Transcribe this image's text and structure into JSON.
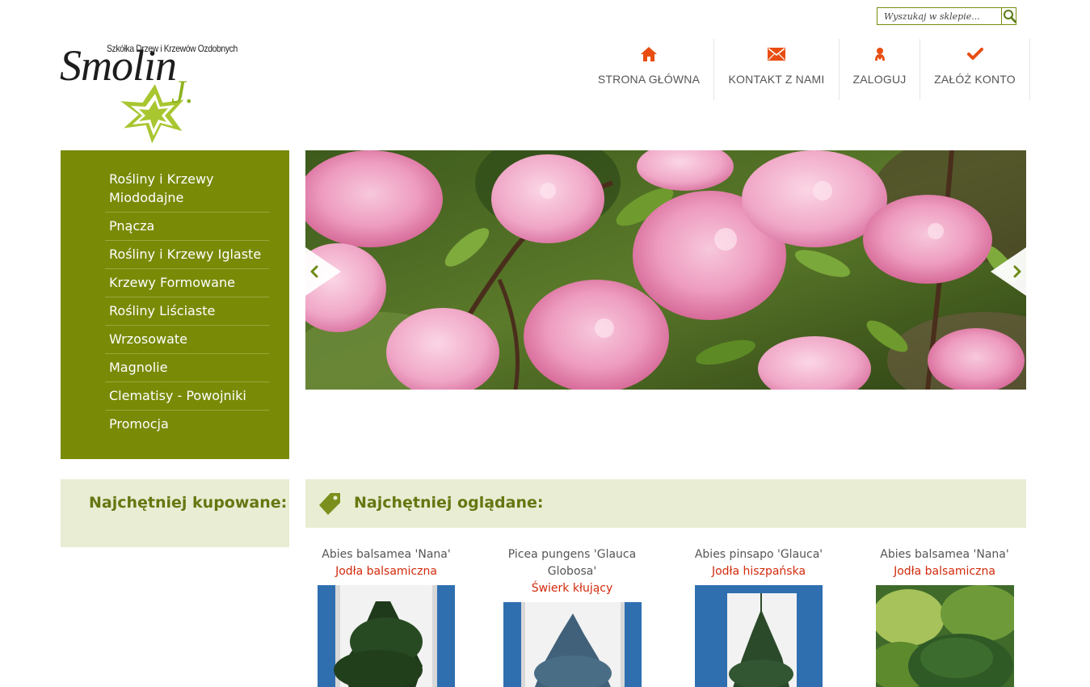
{
  "search": {
    "placeholder": "Wyszukaj w sklepie..."
  },
  "logo": {
    "name": "Smolin",
    "initial": "J.",
    "tagline": "Szkółka Drzew i Krzewów Ozdobnych"
  },
  "topnav": [
    {
      "label": "STRONA GŁÓWNA",
      "icon": "home-icon"
    },
    {
      "label": "KONTAKT Z NAMI",
      "icon": "envelope-icon"
    },
    {
      "label": "ZALOGUJ",
      "icon": "user-icon"
    },
    {
      "label": "ZAŁÓŻ KONTO",
      "icon": "checkmark-icon"
    }
  ],
  "sidebar": {
    "items": [
      {
        "label": "Rośliny i Krzewy Miododajne"
      },
      {
        "label": "Pnącza"
      },
      {
        "label": "Rośliny i Krzewy Iglaste"
      },
      {
        "label": "Krzewy Formowane"
      },
      {
        "label": "Rośliny Liściaste"
      },
      {
        "label": "Wrzosowate"
      },
      {
        "label": "Magnolie"
      },
      {
        "label": "Clematisy - Powojniki"
      },
      {
        "label": "Promocja"
      }
    ]
  },
  "slider": {
    "prev_icon": "chevron-left-icon",
    "next_icon": "chevron-right-icon"
  },
  "bestsellers": {
    "title": "Najchętniej kupowane:"
  },
  "most_viewed": {
    "title": "Najchętniej oglądane:",
    "icon": "tag-icon",
    "products": [
      {
        "latin": "Abies balsamea 'Nana'",
        "polish": "Jodła balsamiczna"
      },
      {
        "latin": "Picea pungens 'Glauca Globosa'",
        "polish": "Świerk kłujący"
      },
      {
        "latin": "Abies pinsapo 'Glauca'",
        "polish": "Jodła hiszpańska"
      },
      {
        "latin": "Abies balsamea 'Nana'",
        "polish": "Jodła balsamiczna"
      }
    ]
  },
  "colors": {
    "green": "#798a06",
    "panel_bg": "#e8edd3",
    "accent_red": "#d22a0c",
    "icon_orange": "#e84e12"
  }
}
